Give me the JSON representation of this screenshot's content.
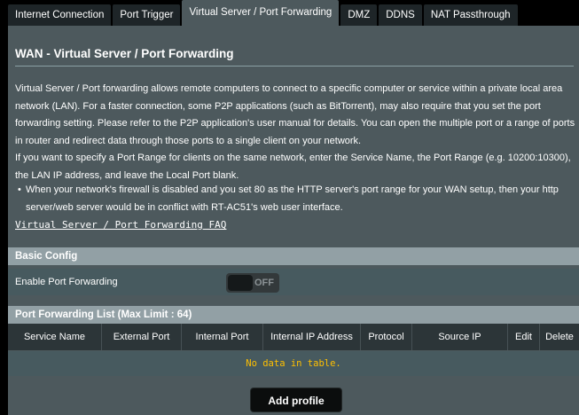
{
  "tabs": [
    {
      "label": "Internet Connection"
    },
    {
      "label": "Port Trigger"
    },
    {
      "label": "Virtual Server / Port Forwarding"
    },
    {
      "label": "DMZ"
    },
    {
      "label": "DDNS"
    },
    {
      "label": "NAT Passthrough"
    }
  ],
  "page": {
    "title": "WAN - Virtual Server / Port Forwarding",
    "desc1": "Virtual Server / Port forwarding allows remote computers to connect to a specific computer or service within a private local area network (LAN). For a faster connection, some P2P applications (such as BitTorrent), may also require that you set the port forwarding setting. Please refer to the P2P application's user manual for details. You can open the multiple port or a range of ports in router and redirect data through those ports to a single client on your network.",
    "desc2": "If you want to specify a Port Range for clients on the same network, enter the Service Name, the Port Range (e.g. 10200:10300), the LAN IP address, and leave the Local Port blank.",
    "bullet": "•",
    "note": "When your network's firewall is disabled and you set 80 as the HTTP server's port range for your WAN setup, then your http server/web server would be in conflict with RT-AC51's web user interface.",
    "faq_link": "Virtual Server / Port Forwarding FAQ"
  },
  "basic_config": {
    "header": "Basic Config",
    "enable_label": "Enable Port Forwarding",
    "toggle_state": "OFF"
  },
  "port_list": {
    "header": "Port Forwarding List (Max Limit : 64)",
    "columns": [
      "Service Name",
      "External Port",
      "Internal Port",
      "Internal IP Address",
      "Protocol",
      "Source IP",
      "Edit",
      "Delete"
    ],
    "empty_text": "No data in table."
  },
  "actions": {
    "add_profile": "Add profile"
  }
}
